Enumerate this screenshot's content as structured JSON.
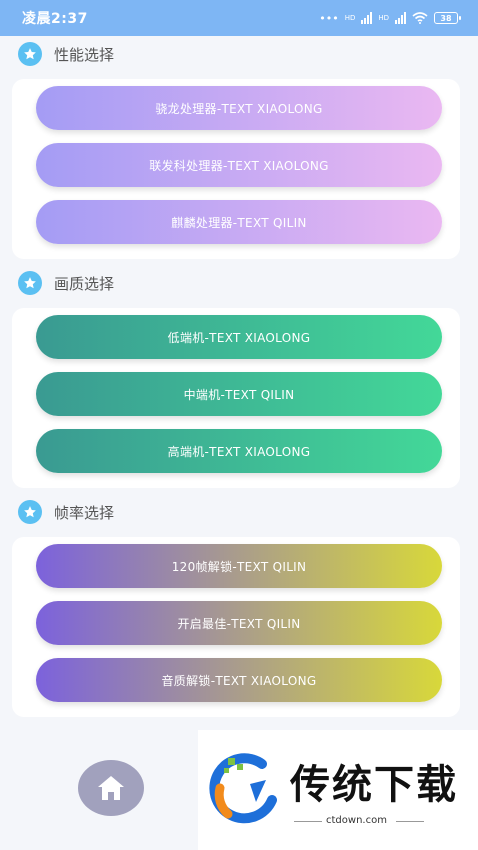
{
  "status_bar": {
    "time": "凌晨2:37",
    "hd1": "HD",
    "hd2": "HD",
    "battery": "38"
  },
  "sections": [
    {
      "title": "性能选择",
      "buttons": [
        "骁龙处理器-TEXT XIAOLONG",
        "联发科处理器-TEXT XIAOLONG",
        "麒麟处理器-TEXT QILIN"
      ]
    },
    {
      "title": "画质选择",
      "buttons": [
        "低端机-TEXT XIAOLONG",
        "中端机-TEXT QILIN",
        "高端机-TEXT XIAOLONG"
      ]
    },
    {
      "title": "帧率选择",
      "buttons": [
        "120帧解锁-TEXT QILIN",
        "开启最佳-TEXT QILIN",
        "音质解锁-TEXT XIAOLONG"
      ]
    }
  ],
  "watermark": {
    "brand": "传统下载",
    "domain": "ctdown.com"
  },
  "colors": {
    "status_bar": "#7eb6f4",
    "section_icon": "#5bc0f2",
    "performance_gradient": [
      "#a49cf4",
      "#eab8f2"
    ],
    "quality_gradient": [
      "#3a9a92",
      "#43d898"
    ],
    "framerate_gradient": [
      "#7c62dc",
      "#d8d83a"
    ],
    "home_button": "#a1a1bd"
  },
  "icons": {
    "section": "star-icon",
    "home": "home-icon"
  }
}
